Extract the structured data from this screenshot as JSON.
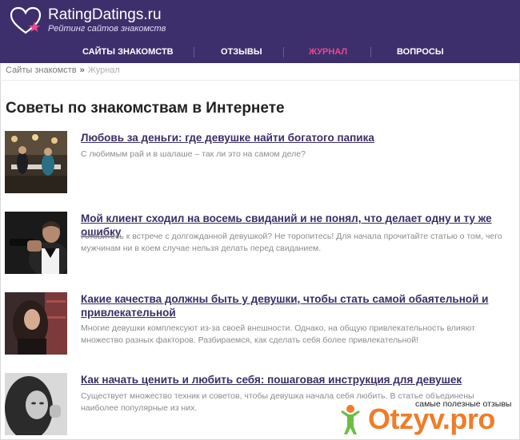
{
  "header": {
    "logo_title": "RatingDatings.ru",
    "logo_subtitle": "Рейтинг сайтов знакомств",
    "nav": [
      {
        "label": "САЙТЫ ЗНАКОМСТВ",
        "active": false
      },
      {
        "label": "ОТЗЫВЫ",
        "active": false
      },
      {
        "label": "ЖУРНАЛ",
        "active": true
      },
      {
        "label": "ВОПРОСЫ",
        "active": false
      }
    ],
    "colors": {
      "background": "#3d2f6b",
      "active": "#e84a8d"
    }
  },
  "breadcrumb": {
    "home": "Сайты знакомств",
    "separator": "»",
    "current": "Журнал"
  },
  "page_title": "Советы по знакомствам в Интернете",
  "articles": [
    {
      "title": "Любовь за деньги: где девушке найти богатого папика",
      "description": "С любимым рай и в шалаше – так ли это на самом деле?"
    },
    {
      "title": "Мой клиент сходил на восемь свиданий и не понял, что делает одну и ту же ошибку",
      "description": "Готовитесь к встрече с долгожданной девушкой? Не торопитесь! Для начала прочитайте статью о том, чего мужчинам ни в коем случае нельзя делать перед свиданием."
    },
    {
      "title": "Какие качества должны быть у девушки, чтобы стать самой обаятельной и привлекательной",
      "description": "Многие девушки комплексуют из-за своей внешности. Однако, на общую привлекательность влияют множество разных факторов. Разбираемся, как сделать себя более привлекательной!"
    },
    {
      "title": "Как начать ценить и любить себя: пошаговая инструкция для девушек",
      "description": "Существует множество техник и советов, чтобы девушка начала себя любить. В статье объединены наиболее популярные из них."
    }
  ],
  "watermark": {
    "caption": "самые полезные отзывы",
    "logo": "Otzyv.pro"
  }
}
